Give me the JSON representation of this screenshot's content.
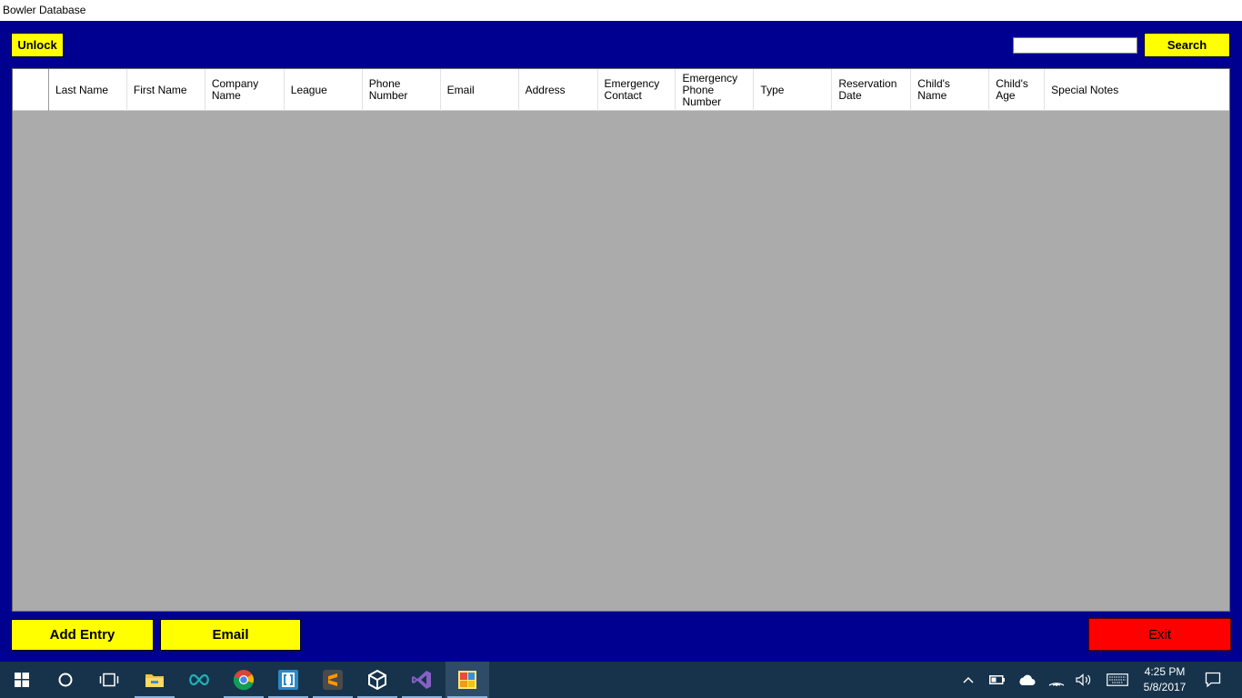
{
  "window": {
    "title": "Bowler Database"
  },
  "toolbar": {
    "unlock_label": "Unlock",
    "search_label": "Search",
    "search_value": ""
  },
  "grid": {
    "columns": [
      "Last Name",
      "First Name",
      "Company\nName",
      "League",
      "Phone\nNumber",
      "Email",
      "Address",
      "Emergency\nContact",
      "Emergency\nPhone\nNumber",
      "Type",
      "Reservation\nDate",
      "Child's\nName",
      "Child's\nAge",
      "Special Notes"
    ],
    "rows": []
  },
  "footer": {
    "add_entry_label": "Add Entry",
    "email_label": "Email",
    "exit_label": "Exit"
  },
  "colors": {
    "background": "#000090",
    "button_yellow": "#ffff00",
    "button_red": "#ff0000",
    "grid_body": "#ababab",
    "taskbar": "#17334b"
  },
  "taskbar": {
    "icons": [
      "windows-start-icon",
      "cortana-icon",
      "task-view-icon",
      "file-explorer-icon",
      "arduino-icon",
      "chrome-icon",
      "brackets-icon",
      "sublime-text-icon",
      "unity-icon",
      "visual-studio-icon",
      "winforms-app-icon"
    ],
    "clock_time": "4:25 PM",
    "clock_date": "5/8/2017"
  }
}
